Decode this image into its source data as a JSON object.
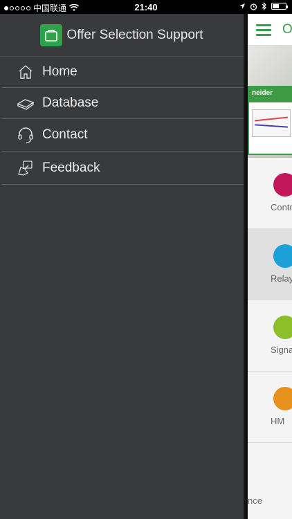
{
  "status_bar": {
    "carrier": "中国联通",
    "time": "21:40"
  },
  "drawer": {
    "app_title": "Offer Selection Support",
    "menu": [
      {
        "label": "Home",
        "icon": "home-icon"
      },
      {
        "label": "Database",
        "icon": "database-icon"
      },
      {
        "label": "Contact",
        "icon": "headset-icon"
      },
      {
        "label": "Feedback",
        "icon": "feedback-icon"
      }
    ]
  },
  "peek": {
    "title": "O",
    "banner_screen_text": "neider",
    "tiles": [
      {
        "label": "Contr",
        "color": "#c2185b"
      },
      {
        "label": "Relay",
        "color": "#1ba1d8"
      },
      {
        "label": "Signal",
        "color": "#8cbf2a"
      },
      {
        "label": "HM",
        "color": "#e8921e"
      }
    ],
    "bottom_text": "nce"
  },
  "colors": {
    "accent": "#2fa24b",
    "drawer_bg": "#393a3c"
  }
}
